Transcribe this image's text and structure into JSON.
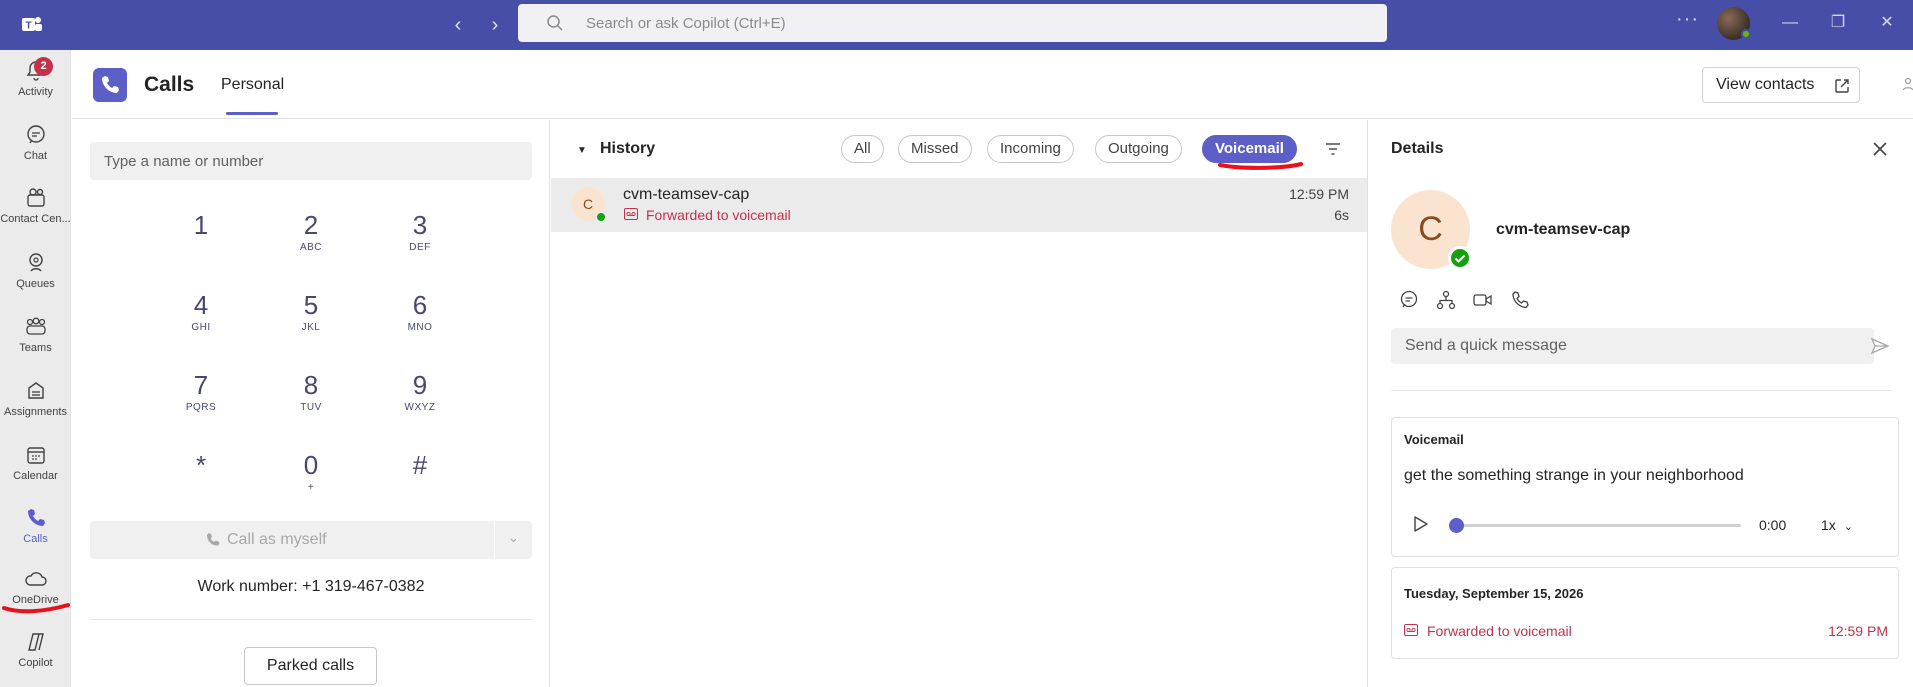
{
  "colors": {
    "titlebar": "#464ea7",
    "accent": "#5b5fc7",
    "missed_red": "#c4314b",
    "presence_green": "#13a10e",
    "annotation_red": "#e8111c"
  },
  "titlebar": {
    "search_placeholder": "Search or ask Copilot (Ctrl+E)",
    "more": "···"
  },
  "rail": {
    "items": [
      {
        "label": "Activity",
        "icon": "bell-icon",
        "badge": "2"
      },
      {
        "label": "Chat",
        "icon": "chat-icon"
      },
      {
        "label": "Contact Cen...",
        "icon": "contact-center-icon"
      },
      {
        "label": "Queues",
        "icon": "queues-icon"
      },
      {
        "label": "Teams",
        "icon": "teams-icon"
      },
      {
        "label": "Assignments",
        "icon": "assignments-icon"
      },
      {
        "label": "Calendar",
        "icon": "calendar-icon"
      },
      {
        "label": "Calls",
        "icon": "phone-icon"
      },
      {
        "label": "OneDrive",
        "icon": "cloud-icon"
      },
      {
        "label": "Copilot",
        "icon": "copilot-icon"
      }
    ]
  },
  "header": {
    "title": "Calls",
    "tab": "Personal",
    "view_contacts": "View contacts"
  },
  "dialpad": {
    "input_placeholder": "Type a name or number",
    "keys": [
      {
        "num": "1",
        "sub": ""
      },
      {
        "num": "2",
        "sub": "ABC"
      },
      {
        "num": "3",
        "sub": "DEF"
      },
      {
        "num": "4",
        "sub": "GHI"
      },
      {
        "num": "5",
        "sub": "JKL"
      },
      {
        "num": "6",
        "sub": "MNO"
      },
      {
        "num": "7",
        "sub": "PQRS"
      },
      {
        "num": "8",
        "sub": "TUV"
      },
      {
        "num": "9",
        "sub": "WXYZ"
      },
      {
        "num": "*",
        "sub": ""
      },
      {
        "num": "0",
        "sub": "+"
      },
      {
        "num": "#",
        "sub": ""
      }
    ],
    "call_label": "Call as myself",
    "work_number": "Work number: +1 319-467-0382",
    "parked_calls": "Parked calls"
  },
  "history": {
    "title": "History",
    "filters": [
      "All",
      "Missed",
      "Incoming",
      "Outgoing",
      "Voicemail"
    ],
    "selected_filter": "Voicemail",
    "rows": [
      {
        "initial": "C",
        "name": "cvm-teamsev-cap",
        "status": "Forwarded to voicemail",
        "time": "12:59 PM",
        "duration": "6s"
      }
    ]
  },
  "details": {
    "title": "Details",
    "initial": "C",
    "name": "cvm-teamsev-cap",
    "quick_message_placeholder": "Send a quick message",
    "voicemail": {
      "title": "Voicemail",
      "transcript": "get the something strange in your neighborhood",
      "position": "0:00",
      "progress": 0,
      "speed": "1x"
    },
    "date_card": {
      "date": "Tuesday, September 15, 2026",
      "status": "Forwarded to voicemail",
      "time": "12:59 PM"
    }
  }
}
